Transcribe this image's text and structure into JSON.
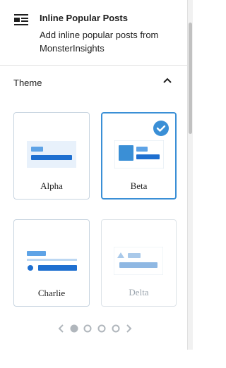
{
  "block": {
    "icon": "list-layout-icon",
    "title": "Inline Popular Posts",
    "description": "Add inline popular posts from MonsterInsights"
  },
  "section": {
    "title": "Theme",
    "expanded": true,
    "toggle_icon": "chevron-up-icon"
  },
  "themes": [
    {
      "name": "Alpha",
      "selected": false,
      "disabled": false
    },
    {
      "name": "Beta",
      "selected": true,
      "disabled": false
    },
    {
      "name": "Charlie",
      "selected": false,
      "disabled": false
    },
    {
      "name": "Delta",
      "selected": false,
      "disabled": true
    }
  ],
  "pagination": {
    "pages": 4,
    "current": 1,
    "prev_icon": "chevron-left-icon",
    "next_icon": "chevron-right-icon"
  },
  "colors": {
    "accent": "#3a8fd6",
    "preview_bg": "#e8f1fb",
    "preview_dark": "#1e6fd0",
    "preview_light": "#5ea3e6"
  }
}
